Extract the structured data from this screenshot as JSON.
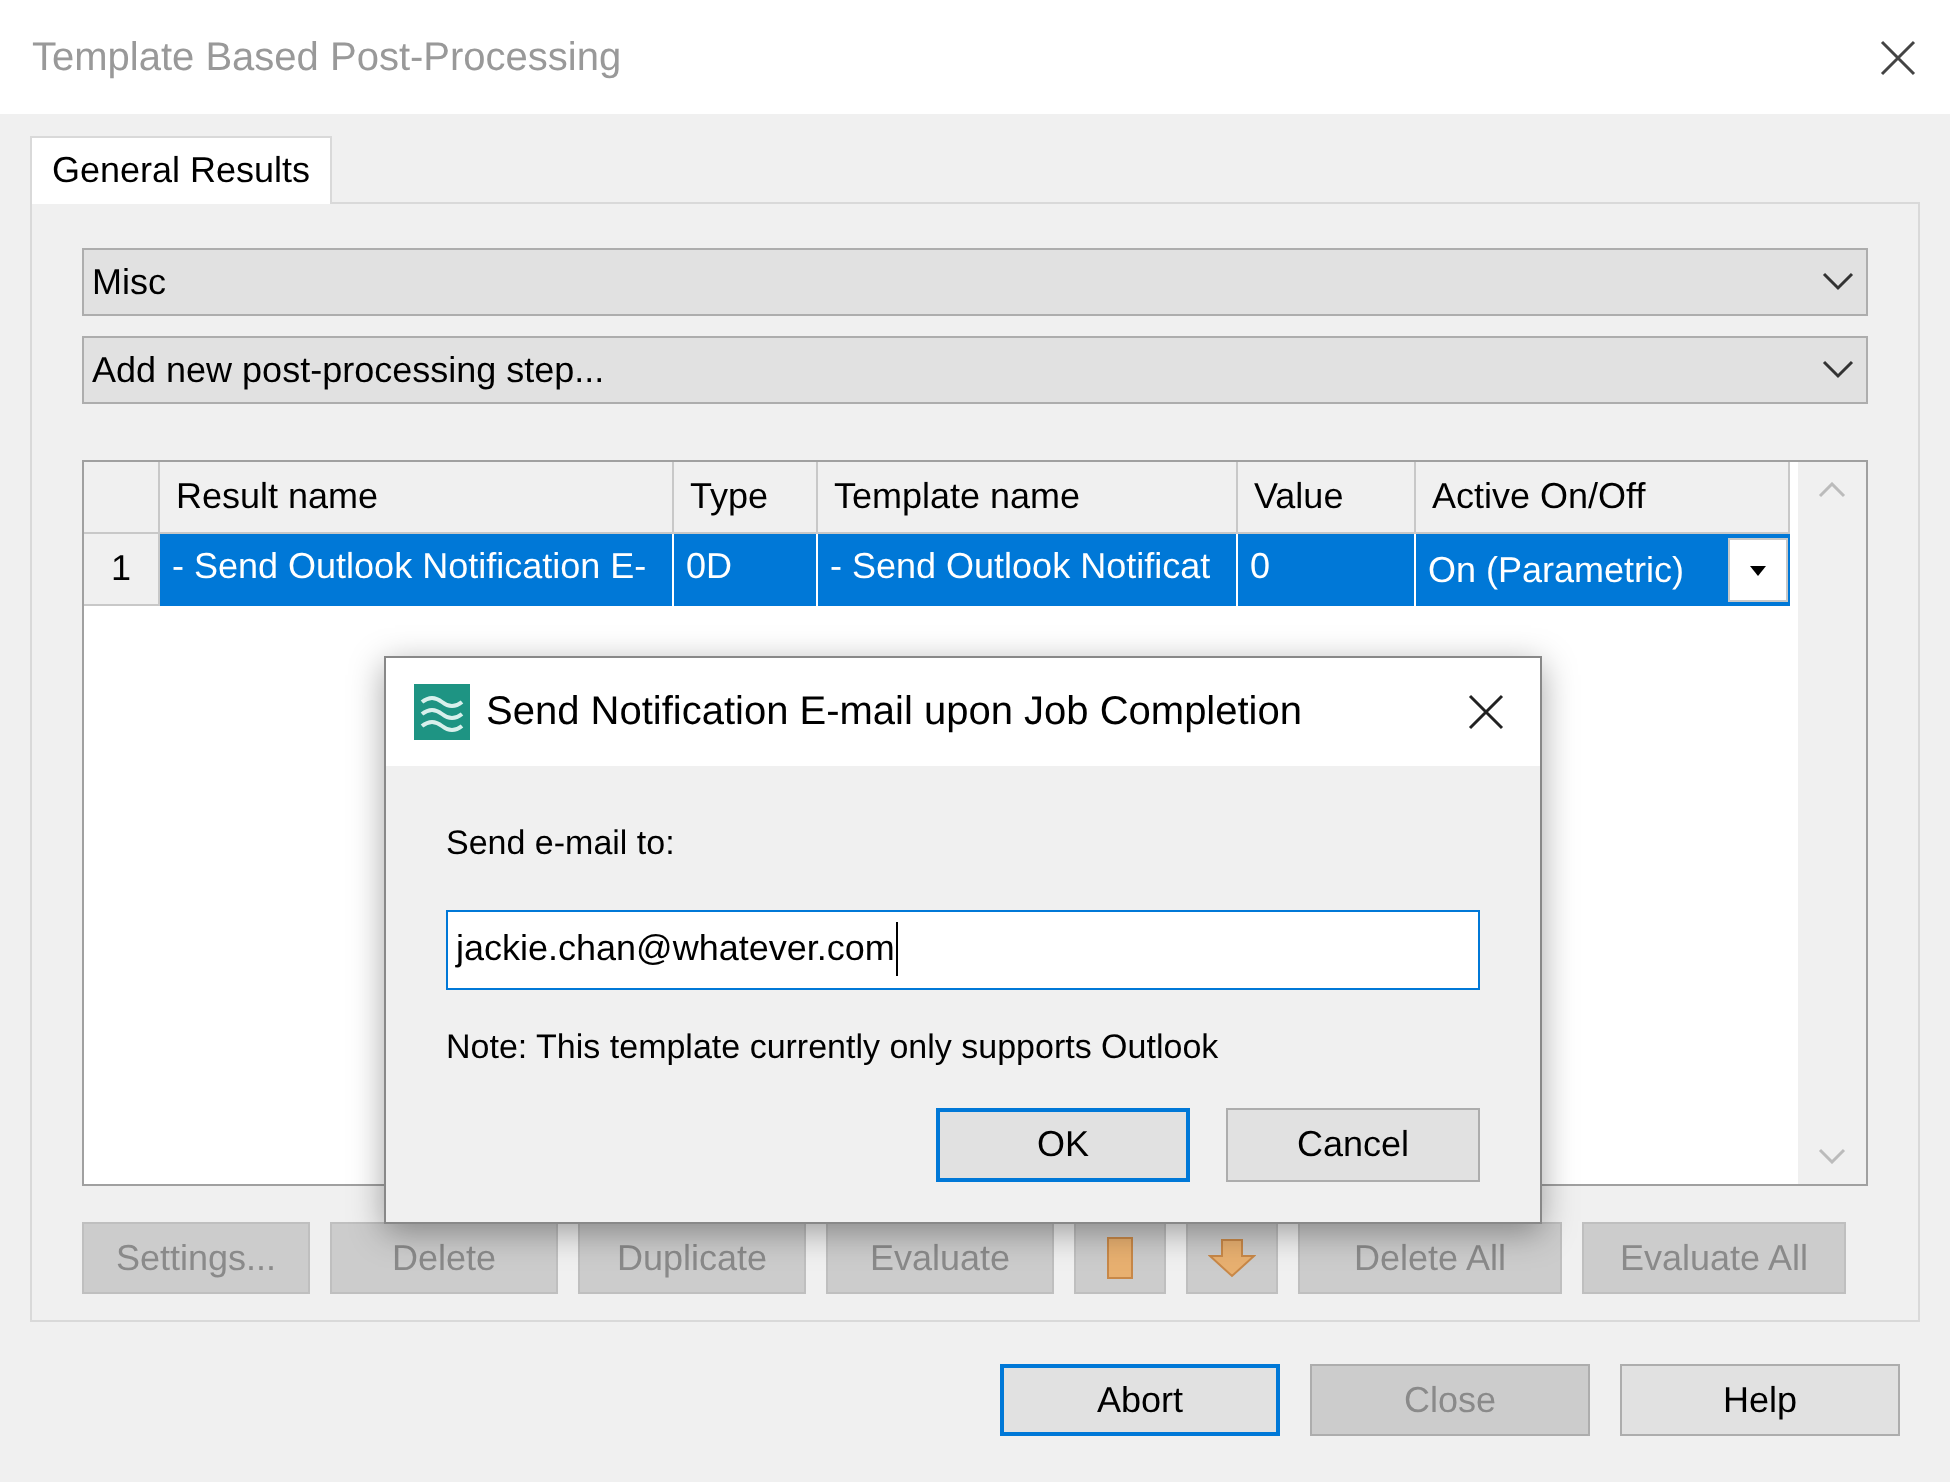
{
  "window": {
    "title": "Template Based Post-Processing"
  },
  "tabs": [
    {
      "label": "General Results",
      "selected": true
    }
  ],
  "combos": [
    {
      "value": "Misc"
    },
    {
      "value": "Add new post-processing step..."
    }
  ],
  "table": {
    "columns": [
      "Result name",
      "Type",
      "Template name",
      "Value",
      "Active On/Off"
    ],
    "rows": [
      {
        "index": "1",
        "selected": true,
        "cells": [
          "- Send Outlook Notification E-",
          "0D",
          "- Send Outlook Notificat",
          "0"
        ],
        "active": "On (Parametric)"
      }
    ]
  },
  "actions": [
    {
      "kind": "text",
      "label": "Settings...",
      "disabled": true
    },
    {
      "kind": "text",
      "label": "Delete",
      "disabled": true
    },
    {
      "kind": "text",
      "label": "Duplicate",
      "disabled": true
    },
    {
      "kind": "text",
      "label": "Evaluate",
      "disabled": true
    },
    {
      "kind": "clipboard",
      "disabled": true
    },
    {
      "kind": "down",
      "disabled": true
    },
    {
      "kind": "text",
      "label": "Delete All",
      "disabled": true
    },
    {
      "kind": "text",
      "label": "Evaluate All",
      "disabled": true
    }
  ],
  "footer": [
    {
      "label": "Abort",
      "disabled": false,
      "focused": true
    },
    {
      "label": "Close",
      "disabled": true,
      "focused": false
    },
    {
      "label": "Help",
      "disabled": false,
      "focused": false
    }
  ],
  "dialog": {
    "title": "Send Notification E-mail upon Job Completion",
    "label": "Send e-mail to:",
    "value": "jackie.chan@whatever.com",
    "note": "Note: This template currently only supports Outlook",
    "buttons": [
      {
        "label": "OK",
        "focused": true
      },
      {
        "label": "Cancel",
        "focused": false
      }
    ]
  }
}
